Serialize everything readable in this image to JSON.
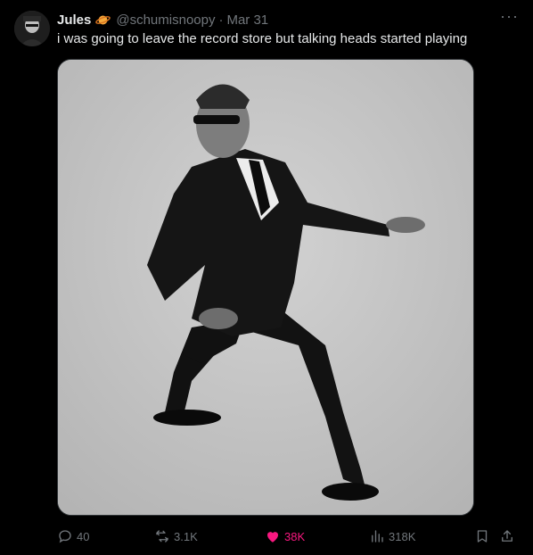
{
  "author": {
    "name": "Jules",
    "handle": "@schumisnoopy",
    "date_sep": "·",
    "date": "Mar 31",
    "badge_icon": "planet-icon"
  },
  "tweet": {
    "text": "i was going to leave the record store but talking heads started playing"
  },
  "actions": {
    "replies": "40",
    "reposts": "3.1K",
    "likes": "38K",
    "views": "318K"
  },
  "colors": {
    "background": "#000000",
    "text": "#e7e9ea",
    "muted": "#71767b",
    "like": "#f91880",
    "badge": "#f4a93b"
  }
}
